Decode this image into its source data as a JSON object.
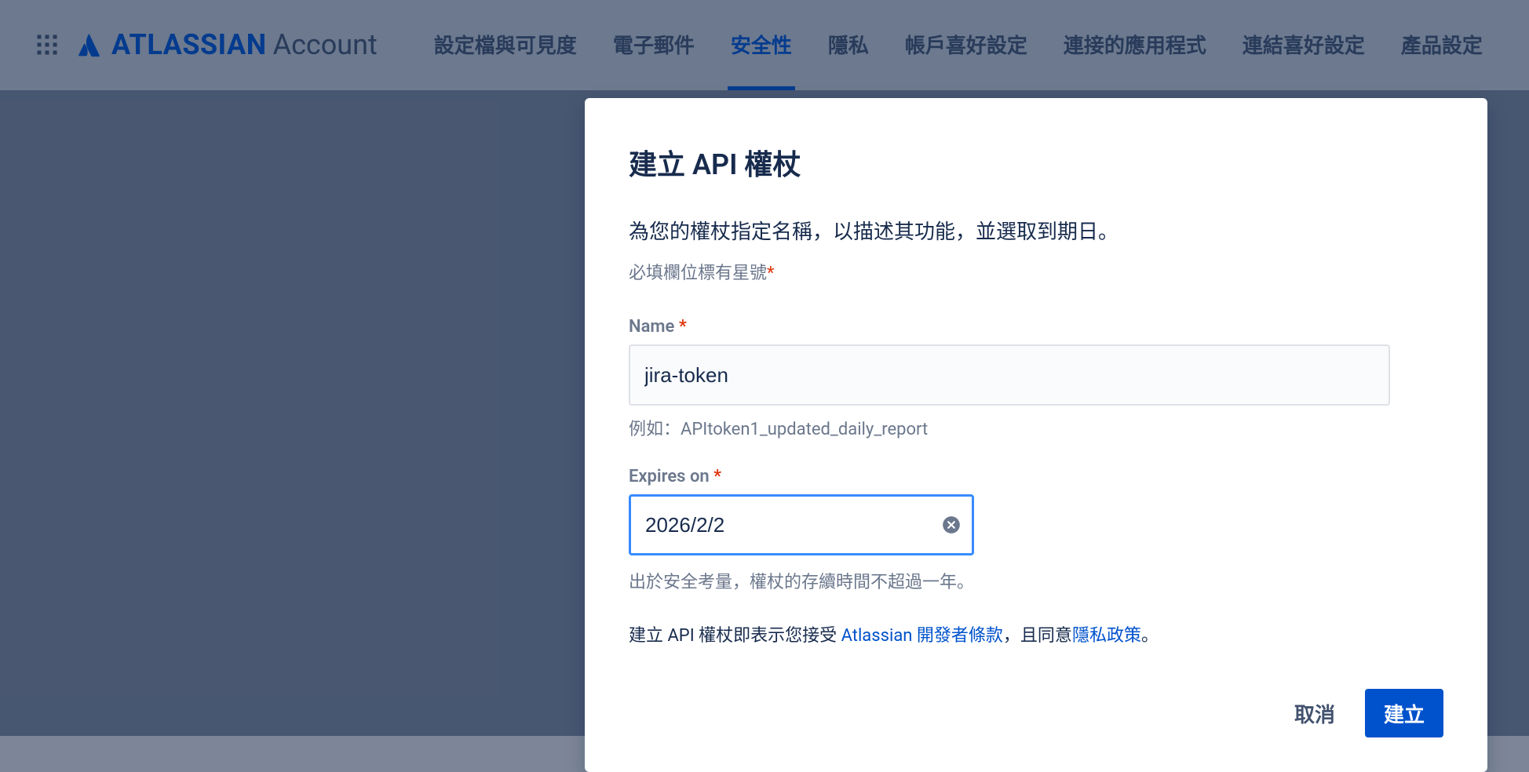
{
  "header": {
    "brand_name": "ATLASSIAN",
    "brand_sub": "Account"
  },
  "nav": {
    "items": [
      "設定檔與可見度",
      "電子郵件",
      "安全性",
      "隱私",
      "帳戶喜好設定",
      "連接的應用程式",
      "連結喜好設定",
      "產品設定"
    ],
    "active_index": 2
  },
  "modal": {
    "title": "建立 API 權杖",
    "description": "為您的權杖指定名稱，以描述其功能，並選取到期日。",
    "required_note": "必填欄位標有星號",
    "name_field": {
      "label": "Name",
      "value": "jira-token",
      "help": "例如：APItoken1_updated_daily_report"
    },
    "expires_field": {
      "label": "Expires on",
      "value": "2026/2/2",
      "note": "出於安全考量，權杖的存續時間不超過一年。"
    },
    "terms": {
      "prefix": "建立 API 權杖即表示您接受 ",
      "dev_terms_link": "Atlassian 開發者條款",
      "middle": "，且同意",
      "privacy_link": "隱私政策",
      "suffix": "。"
    },
    "actions": {
      "cancel": "取消",
      "create": "建立"
    }
  }
}
